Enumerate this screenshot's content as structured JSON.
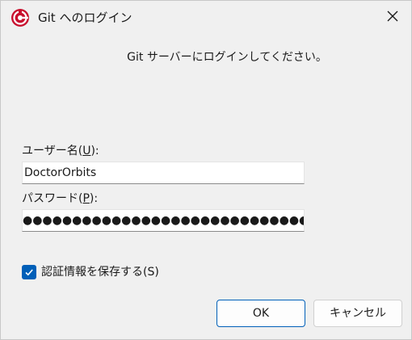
{
  "window": {
    "title": "Git へのログイン",
    "app_icon": "git-login-app-icon",
    "close_icon": "close-icon"
  },
  "header": {
    "message": "Git サーバーにログインしてください。"
  },
  "username": {
    "label_prefix": "ユーザー名(",
    "label_mnemonic": "U",
    "label_suffix": "):",
    "value": "DoctorOrbits"
  },
  "password": {
    "label_prefix": "パスワード(",
    "label_mnemonic": "P",
    "label_suffix": "):",
    "masked_value": "●●●●●●●●●●●●●●●●●●●●●●●●●●●●●●●●●●"
  },
  "save_credentials": {
    "label": "認証情報を保存する(S)",
    "checked": true
  },
  "buttons": {
    "ok": "OK",
    "cancel": "キャンセル"
  },
  "colors": {
    "accent": "#005fb8",
    "icon_red": "#c8102e",
    "background": "#f0f0f0"
  }
}
